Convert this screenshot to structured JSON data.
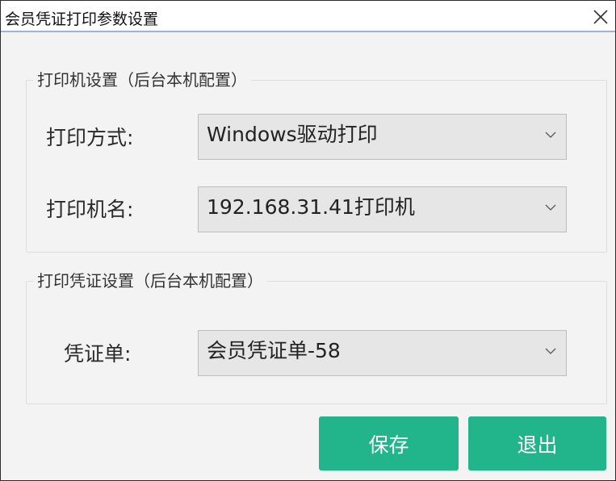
{
  "window": {
    "title": "会员凭证打印参数设置"
  },
  "printer_group": {
    "legend": "打印机设置（后台本机配置）",
    "print_mode": {
      "label": "打印方式:",
      "value": "Windows驱动打印"
    },
    "printer_name": {
      "label": "打印机名:",
      "value": "192.168.31.41打印机"
    }
  },
  "voucher_group": {
    "legend": "打印凭证设置（后台本机配置）",
    "voucher": {
      "label": "凭证单:",
      "value": "会员凭证单-58"
    }
  },
  "buttons": {
    "save": "保存",
    "exit": "退出"
  },
  "colors": {
    "accent": "#22b48a",
    "select_bg": "#e6e6e6",
    "panel_bg": "#f3f3f3",
    "titlebar_border": "#9fb3d9"
  },
  "icons": {
    "close": "close-icon",
    "dropdown": "chevron-down-icon"
  }
}
